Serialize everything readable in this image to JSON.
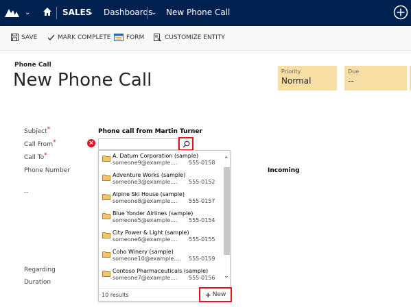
{
  "nav": {
    "area": "SALES",
    "section": "Dashboards",
    "record": "New Phone Call"
  },
  "commands": {
    "save": "SAVE",
    "mark_complete": "MARK COMPLETE",
    "form": "FORM",
    "customize": "CUSTOMIZE ENTITY"
  },
  "header": {
    "entity_type": "Phone Call",
    "title": "New Phone Call",
    "fields": [
      {
        "label": "Priority",
        "value": "Normal"
      },
      {
        "label": "Due",
        "value": "--"
      }
    ]
  },
  "form": {
    "subject_label": "Subject",
    "subject_value": "Phone call from Martin Turner",
    "call_from_label": "Call From",
    "call_to_label": "Call To",
    "phone_label": "Phone Number",
    "direction_value": "Incoming",
    "empty_value": "--",
    "regarding_label": "Regarding",
    "duration_label": "Duration",
    "required_mark": "*"
  },
  "lookup": {
    "results": [
      {
        "name": "A. Datum Corporation (sample)",
        "email": "someone9@example....",
        "phone": "555-0158"
      },
      {
        "name": "Adventure Works (sample)",
        "email": "someone3@example....",
        "phone": "555-0152"
      },
      {
        "name": "Alpine Ski House (sample)",
        "email": "someone8@example....",
        "phone": "555-0157"
      },
      {
        "name": "Blue Yonder Airlines (sample)",
        "email": "someone5@example....",
        "phone": "555-0154"
      },
      {
        "name": "City Power & Light (sample)",
        "email": "someone6@example....",
        "phone": "555-0155"
      },
      {
        "name": "Coho Winery (sample)",
        "email": "someone10@example....",
        "phone": "555-0159"
      },
      {
        "name": "Contoso Pharmaceuticals (sample)",
        "email": "someone7@example....",
        "phone": "555-0156"
      }
    ],
    "count": "10 results",
    "new_label": "New"
  },
  "colors": {
    "nav_bg": "#002050",
    "header_field_bg": "#f6dea5",
    "highlight": "#e81123"
  }
}
